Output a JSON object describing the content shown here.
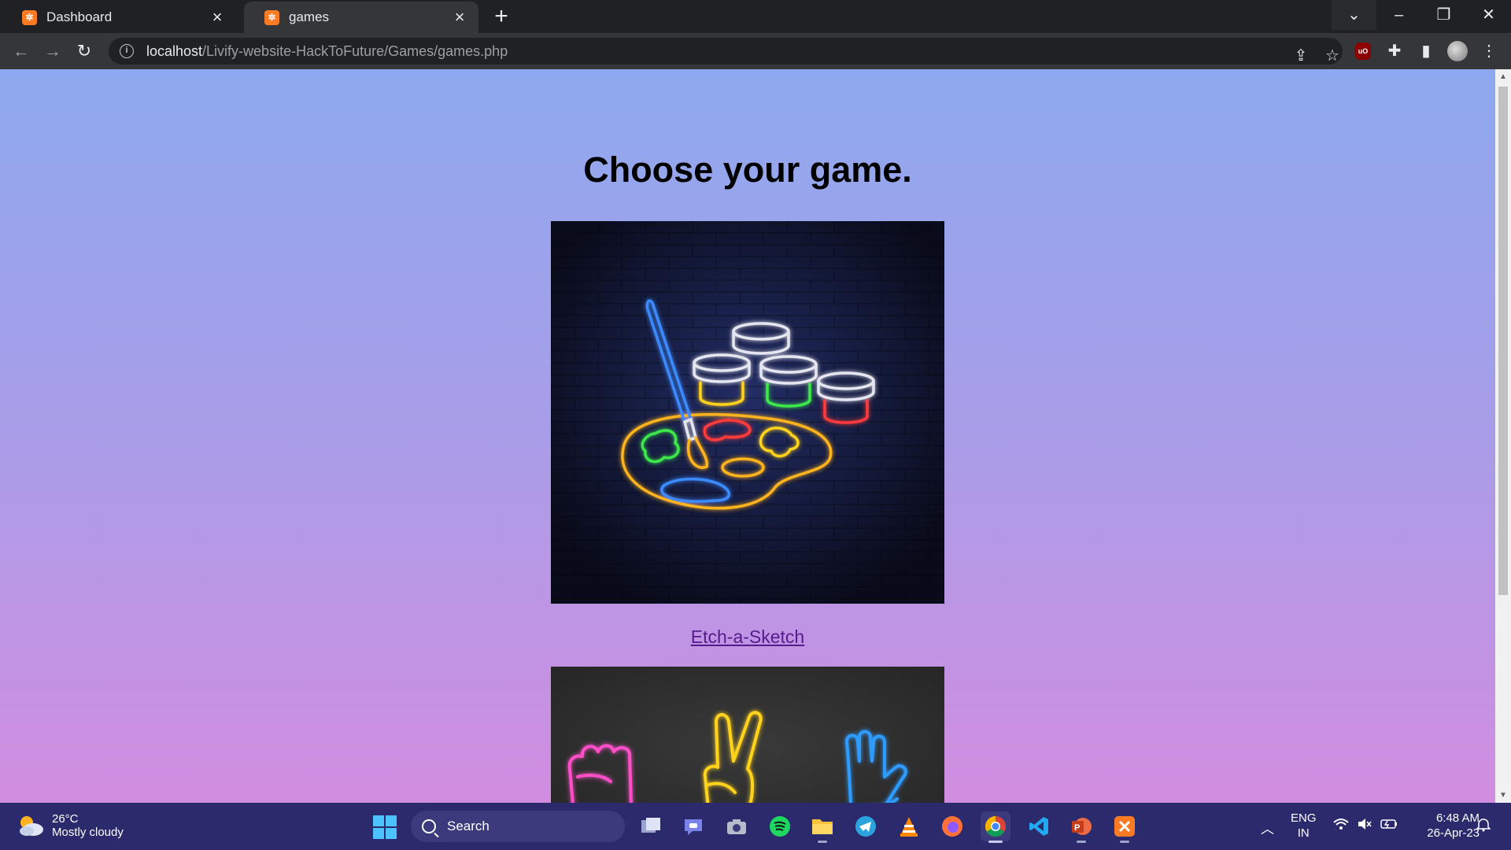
{
  "browser": {
    "tabs": [
      {
        "title": "Dashboard",
        "active": false
      },
      {
        "title": "games",
        "active": true
      }
    ],
    "address": {
      "host": "localhost",
      "path": "/Livify-website-HackToFuture/Games/games.php"
    }
  },
  "page": {
    "title": "Choose your game.",
    "games": [
      {
        "link_text": "Etch-a-Sketch",
        "image": "neon-paint-palette"
      },
      {
        "link_text": "",
        "image": "neon-rock-paper-scissors-hands"
      }
    ],
    "link_color": "#551a8b"
  },
  "taskbar": {
    "weather": {
      "temp": "26°C",
      "desc": "Mostly cloudy"
    },
    "search_placeholder": "Search",
    "language": {
      "line1": "ENG",
      "line2": "IN"
    },
    "clock": {
      "time": "6:48 AM",
      "date": "26-Apr-23"
    },
    "apps": [
      "file-explorer-view",
      "teams-chat",
      "camera",
      "spotify",
      "file-explorer",
      "telegram",
      "vlc",
      "firefox",
      "chrome",
      "vscode",
      "powerpoint",
      "xampp"
    ]
  }
}
